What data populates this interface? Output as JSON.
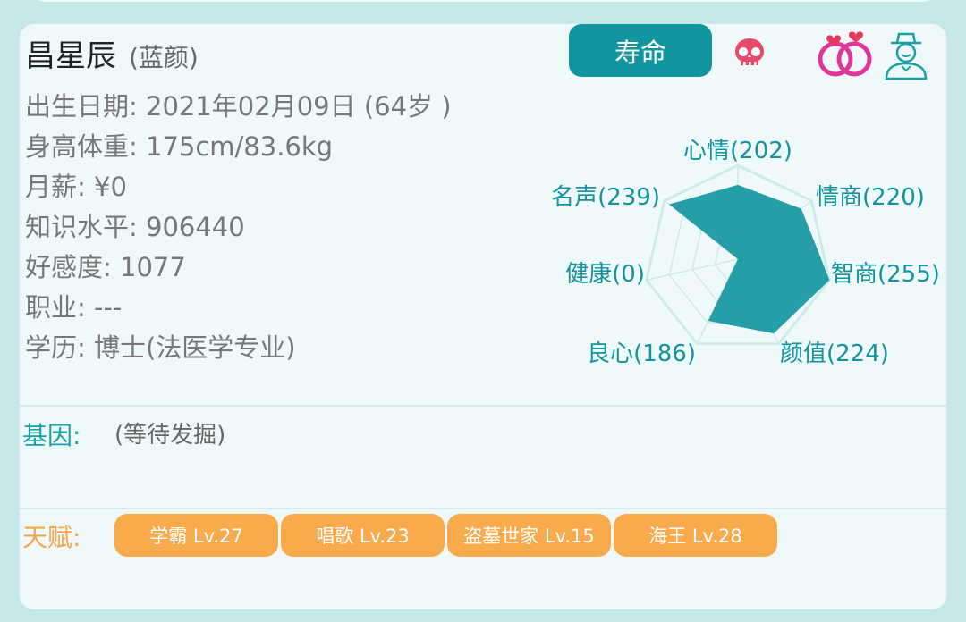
{
  "profile": {
    "name": "昌星辰",
    "alias": "(蓝颜)",
    "birth": "出生日期: 2021年02月09日 (64岁 )",
    "body": "身高体重: 175cm/83.6kg",
    "salary": "月薪: ¥0",
    "knowledge": "知识水平: 906440",
    "affection": "好感度: 1077",
    "job": "职业: ---",
    "education": "学历: 博士(法医学专业)"
  },
  "header": {
    "lifespan_button": "寿命",
    "icons": [
      "skull-icon",
      "rings-icon",
      "butler-icon"
    ]
  },
  "radar": {
    "labels": {
      "mood": "心情(202)",
      "eq": "情商(220)",
      "iq": "智商(255)",
      "looks": "颜值(224)",
      "conscience": "良心(186)",
      "health": "健康(0)",
      "fame": "名声(239)"
    },
    "values": [
      202,
      220,
      255,
      224,
      186,
      0,
      239
    ],
    "max": 255,
    "fill_color": "#14969f",
    "grid_color": "#cfeaea"
  },
  "gene": {
    "label": "基因:",
    "value": "(等待发掘)"
  },
  "talents": {
    "label": "天赋:",
    "items": [
      "学霸 Lv.27",
      "唱歌 Lv.23",
      "盗墓世家 Lv.15",
      "海王 Lv.28"
    ]
  },
  "colors": {
    "teal": "#12959e",
    "orange": "#f9ab4c",
    "background": "#c6e8e8"
  }
}
